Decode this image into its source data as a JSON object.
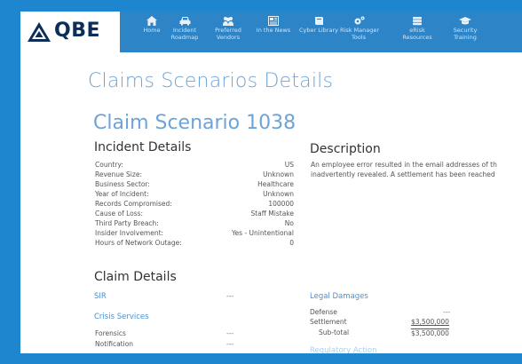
{
  "brand": {
    "name": "QBE"
  },
  "nav": [
    {
      "icon": "home-icon",
      "label1": "Home",
      "label2": ""
    },
    {
      "icon": "car-icon",
      "label1": "Incident",
      "label2": "Roadmap"
    },
    {
      "icon": "people-icon",
      "label1": "Preferred",
      "label2": "Vendors"
    },
    {
      "icon": "newspaper-icon",
      "label1": "In the News",
      "label2": ""
    },
    {
      "icon": "book-icon",
      "label1": "Cyber Library",
      "label2": ""
    },
    {
      "icon": "gears-icon",
      "label1": "Risk Manager",
      "label2": "Tools"
    },
    {
      "icon": "stack-icon",
      "label1": "eRisk",
      "label2": "Resources"
    },
    {
      "icon": "graduation-cap-icon",
      "label1": "Security",
      "label2": "Training"
    }
  ],
  "page_title": "Claims Scenarios Details",
  "scenario_title": "Claim Scenario 1038",
  "incident": {
    "heading": "Incident Details",
    "rows": [
      {
        "k": "Country:",
        "v": "US"
      },
      {
        "k": "Revenue Size:",
        "v": "Unknown"
      },
      {
        "k": "Business Sector:",
        "v": "Healthcare"
      },
      {
        "k": "Year of Incident:",
        "v": "Unknown"
      },
      {
        "k": "Records Compromised:",
        "v": "100000"
      },
      {
        "k": "Cause of Loss:",
        "v": "Staff Mistake"
      },
      {
        "k": "Third Party Breach:",
        "v": "No"
      },
      {
        "k": "Insider Involvement:",
        "v": "Yes - Unintentional"
      },
      {
        "k": "Hours of Network Outage:",
        "v": "0"
      }
    ]
  },
  "description": {
    "heading": "Description",
    "line1": "An employee error resulted in the email addresses of th",
    "line2": "inadvertently revealed. A settlement has been reached"
  },
  "claim": {
    "heading": "Claim Details",
    "sir_label": "SIR",
    "sir_value": "---",
    "crisis_heading": "Crisis Services",
    "forensics_label": "Forensics",
    "forensics_value": "---",
    "notification_label": "Notification",
    "notification_value": "---"
  },
  "legal": {
    "heading": "Legal Damages",
    "defense_label": "Defense",
    "defense_value": "---",
    "settlement_label": "Settlement",
    "settlement_value": "$3,500,000",
    "subtotal_label": "Sub-total",
    "subtotal_value": "$3,500,000",
    "regulatory_heading": "Regulatory Action"
  },
  "colors": {
    "background": "#1d86cf",
    "nav": "#2d84c7",
    "accent": "#6fa3d6",
    "link": "#4a90d6"
  }
}
